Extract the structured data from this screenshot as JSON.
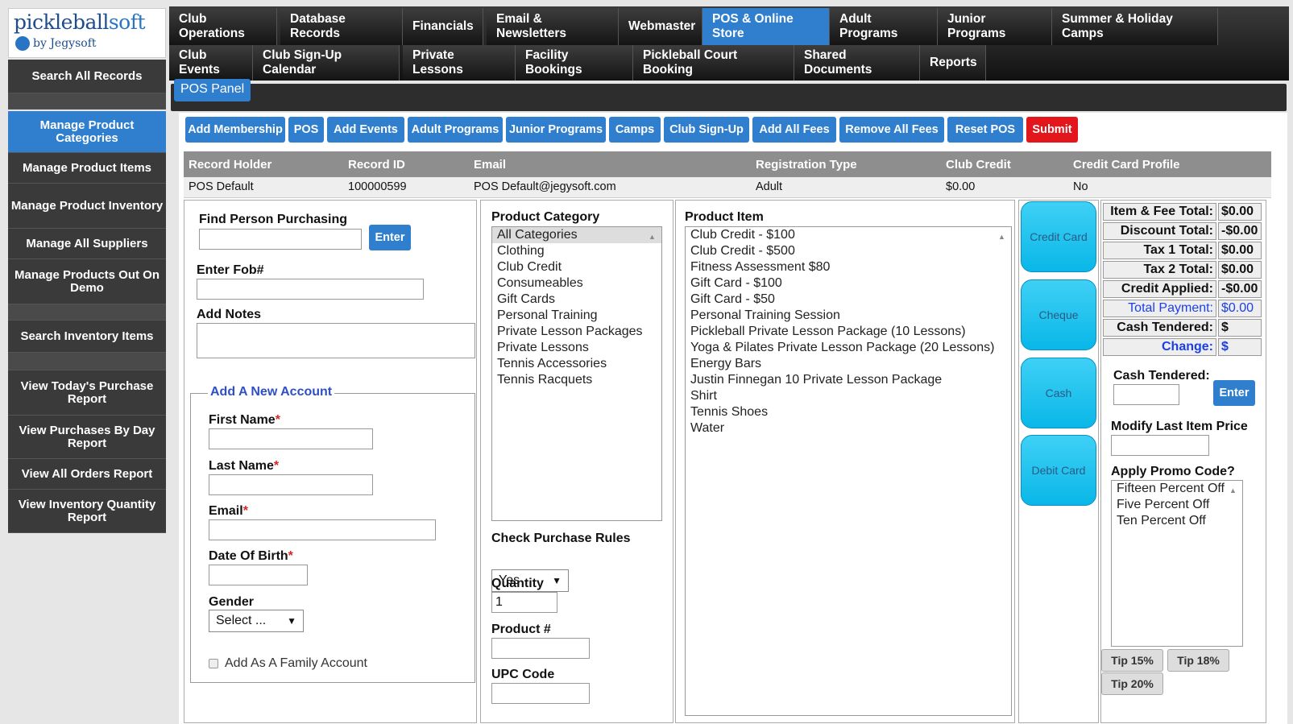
{
  "logo": {
    "brand_a": "pickleball",
    "brand_b": "soft",
    "byline": "by Jegysoft"
  },
  "sidebar": {
    "items": [
      {
        "label": "Search All Records"
      },
      {
        "label": "Manage Product Categories"
      },
      {
        "label": "Manage Product Items"
      },
      {
        "label": "Manage Product Inventory"
      },
      {
        "label": "Manage All Suppliers"
      },
      {
        "label": "Manage Products Out On Demo"
      },
      {
        "label": "Search Inventory Items"
      },
      {
        "label": "View Today's Purchase Report"
      },
      {
        "label": "View Purchases By Day Report"
      },
      {
        "label": "View All Orders Report"
      },
      {
        "label": "View Inventory Quantity Report"
      }
    ]
  },
  "topnav": {
    "row1": [
      "Club Operations",
      "Database Records",
      "Financials",
      "Email & Newsletters",
      "Webmaster",
      "POS & Online Store",
      "Adult Programs",
      "Junior Programs",
      "Summer & Holiday Camps"
    ],
    "row2": [
      "Club Events",
      "Club Sign-Up Calendar",
      "Private Lessons",
      "Facility Bookings",
      "Pickleball Court Booking",
      "Shared Documents",
      "Reports"
    ]
  },
  "panel_title": "POS Panel",
  "actions": [
    "Add Membership",
    "POS",
    "Add Events",
    "Adult Programs",
    "Junior Programs",
    "Camps",
    "Club Sign-Up",
    "Add All Fees",
    "Remove All Fees",
    "Reset POS",
    "Submit"
  ],
  "record": {
    "headers": [
      "Record Holder",
      "Record ID",
      "Email",
      "Registration Type",
      "Club Credit",
      "Credit Card Profile"
    ],
    "values": [
      "POS Default",
      "100000599",
      "POS Default@jegysoft.com",
      "Adult",
      "$0.00",
      "No"
    ]
  },
  "person": {
    "find_label": "Find Person Purchasing",
    "enter": "Enter",
    "fob_label": "Enter Fob#",
    "notes_label": "Add Notes",
    "account_legend": "Add A New Account",
    "first": "First Name",
    "last": "Last Name",
    "email": "Email",
    "dob": "Date Of Birth",
    "required": "*",
    "gender": "Gender",
    "gender_value": "Select ...",
    "family": "Add As A Family Account"
  },
  "category": {
    "label": "Product Category",
    "items": [
      "All Categories",
      "Clothing",
      "Club Credit",
      "Consumeables",
      "Gift Cards",
      "Personal Training",
      "Private Lesson Packages",
      "Private Lessons",
      "Tennis Accessories",
      "Tennis Racquets"
    ],
    "rules_label": "Check Purchase Rules",
    "rules_value": "Yes",
    "qty_label": "Quantity",
    "qty_value": "1",
    "product_label": "Product #",
    "upc_label": "UPC Code"
  },
  "product": {
    "label": "Product Item",
    "items": [
      "Club Credit - $100",
      "Club Credit - $500",
      "Fitness Assessment $80",
      "Gift Card - $100",
      "Gift Card - $50",
      "Personal Training Session",
      "Pickleball Private Lesson Package (10 Lessons)",
      "Yoga & Pilates Private Lesson Package (20 Lessons)",
      "Energy Bars",
      "Justin Finnegan 10 Private Lesson Package",
      "Shirt",
      "Tennis Shoes",
      "Water"
    ]
  },
  "payments": [
    "Credit Card",
    "Cheque",
    "Cash",
    "Debit Card"
  ],
  "totals": [
    {
      "label": "Item & Fee Total:",
      "value": "$0.00"
    },
    {
      "label": "Discount Total:",
      "value": "-$0.00"
    },
    {
      "label": "Tax 1 Total:",
      "value": "$0.00"
    },
    {
      "label": "Tax 2 Total:",
      "value": "$0.00"
    },
    {
      "label": "Credit Applied:",
      "value": "-$0.00"
    },
    {
      "label": "Total Payment:",
      "value": "$0.00"
    },
    {
      "label": "Cash Tendered:",
      "value": "$"
    },
    {
      "label": "Change:",
      "value": "$"
    }
  ],
  "cash": {
    "label": "Cash Tendered:",
    "enter": "Enter",
    "modify_label": "Modify Last Item Price",
    "promo_label": "Apply Promo Code?",
    "promos": [
      "Fifteen Percent Off",
      "Five Percent Off",
      "Ten Percent Off"
    ],
    "tips": [
      "Tip 15%",
      "Tip 18%",
      "Tip 20%"
    ]
  },
  "colors": {
    "accent": "#2f7fce",
    "submit": "#e3161c",
    "pay_button": "#1cc3ee"
  }
}
